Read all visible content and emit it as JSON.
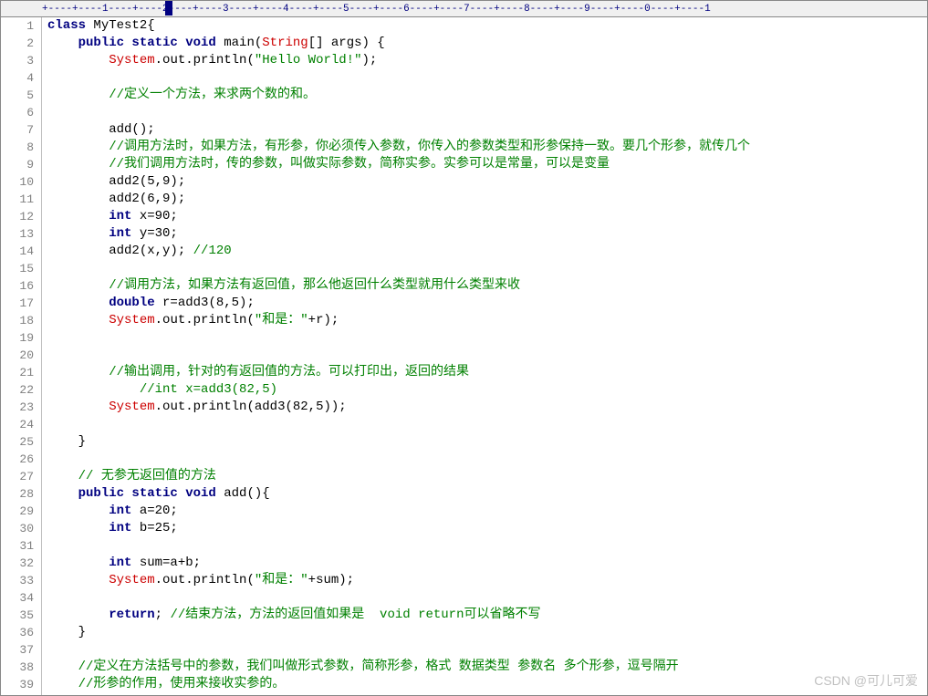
{
  "ruler": "+----+----1----+----2----+----3----+----4----+----5----+----6----+----7----+----8----+----9----+----0----+----1",
  "watermark": "CSDN @可儿可爱",
  "lines": [
    {
      "n": 1,
      "seg": [
        {
          "t": "class ",
          "c": "kw"
        },
        {
          "t": "MyTest2{",
          "c": ""
        }
      ]
    },
    {
      "n": 2,
      "seg": [
        {
          "t": "    ",
          "c": ""
        },
        {
          "t": "public static void ",
          "c": "kw"
        },
        {
          "t": "main(",
          "c": ""
        },
        {
          "t": "String",
          "c": "cls"
        },
        {
          "t": "[] args) {",
          "c": ""
        }
      ]
    },
    {
      "n": 3,
      "seg": [
        {
          "t": "        ",
          "c": ""
        },
        {
          "t": "System",
          "c": "cls"
        },
        {
          "t": ".out.println(",
          "c": ""
        },
        {
          "t": "\"Hello World!\"",
          "c": "str"
        },
        {
          "t": ");",
          "c": ""
        }
      ]
    },
    {
      "n": 4,
      "seg": [
        {
          "t": "",
          "c": ""
        }
      ]
    },
    {
      "n": 5,
      "seg": [
        {
          "t": "        ",
          "c": ""
        },
        {
          "t": "//定义一个方法，来求两个数的和。",
          "c": "cmt"
        }
      ]
    },
    {
      "n": 6,
      "seg": [
        {
          "t": "",
          "c": ""
        }
      ]
    },
    {
      "n": 7,
      "seg": [
        {
          "t": "        add();",
          "c": ""
        }
      ]
    },
    {
      "n": 8,
      "seg": [
        {
          "t": "        ",
          "c": ""
        },
        {
          "t": "//调用方法时，如果方法，有形参，你必须传入参数，你传入的参数类型和形参保持一致。要几个形参，就传几个",
          "c": "cmt"
        }
      ]
    },
    {
      "n": 9,
      "seg": [
        {
          "t": "        ",
          "c": ""
        },
        {
          "t": "//我们调用方法时，传的参数，叫做实际参数，简称实参。实参可以是常量，可以是变量",
          "c": "cmt"
        }
      ]
    },
    {
      "n": 10,
      "seg": [
        {
          "t": "        add2(5,9);",
          "c": ""
        }
      ]
    },
    {
      "n": 11,
      "seg": [
        {
          "t": "        add2(6,9);",
          "c": ""
        }
      ]
    },
    {
      "n": 12,
      "seg": [
        {
          "t": "        ",
          "c": ""
        },
        {
          "t": "int ",
          "c": "kw"
        },
        {
          "t": "x=90;",
          "c": ""
        }
      ]
    },
    {
      "n": 13,
      "seg": [
        {
          "t": "        ",
          "c": ""
        },
        {
          "t": "int ",
          "c": "kw"
        },
        {
          "t": "y=30;",
          "c": ""
        }
      ]
    },
    {
      "n": 14,
      "seg": [
        {
          "t": "        add2(x,y); ",
          "c": ""
        },
        {
          "t": "//120",
          "c": "cmt"
        }
      ]
    },
    {
      "n": 15,
      "seg": [
        {
          "t": "",
          "c": ""
        }
      ]
    },
    {
      "n": 16,
      "seg": [
        {
          "t": "        ",
          "c": ""
        },
        {
          "t": "//调用方法，如果方法有返回值，那么他返回什么类型就用什么类型来收",
          "c": "cmt"
        }
      ]
    },
    {
      "n": 17,
      "seg": [
        {
          "t": "        ",
          "c": ""
        },
        {
          "t": "double ",
          "c": "kw"
        },
        {
          "t": "r=add3(8,5);",
          "c": ""
        }
      ]
    },
    {
      "n": 18,
      "seg": [
        {
          "t": "        ",
          "c": ""
        },
        {
          "t": "System",
          "c": "cls"
        },
        {
          "t": ".out.println(",
          "c": ""
        },
        {
          "t": "\"和是：\"",
          "c": "str"
        },
        {
          "t": "+r);",
          "c": ""
        }
      ]
    },
    {
      "n": 19,
      "seg": [
        {
          "t": "",
          "c": ""
        }
      ]
    },
    {
      "n": 20,
      "seg": [
        {
          "t": "",
          "c": ""
        }
      ]
    },
    {
      "n": 21,
      "seg": [
        {
          "t": "        ",
          "c": ""
        },
        {
          "t": "//输出调用，针对的有返回值的方法。可以打印出，返回的结果",
          "c": "cmt"
        }
      ]
    },
    {
      "n": 22,
      "seg": [
        {
          "t": "            ",
          "c": ""
        },
        {
          "t": "//int x=add3(82,5)",
          "c": "cmt"
        }
      ]
    },
    {
      "n": 23,
      "seg": [
        {
          "t": "        ",
          "c": ""
        },
        {
          "t": "System",
          "c": "cls"
        },
        {
          "t": ".out.println(add3(82,5));",
          "c": ""
        }
      ]
    },
    {
      "n": 24,
      "seg": [
        {
          "t": "",
          "c": ""
        }
      ]
    },
    {
      "n": 25,
      "seg": [
        {
          "t": "    }",
          "c": ""
        }
      ]
    },
    {
      "n": 26,
      "seg": [
        {
          "t": "",
          "c": ""
        }
      ]
    },
    {
      "n": 27,
      "seg": [
        {
          "t": "    ",
          "c": ""
        },
        {
          "t": "// 无参无返回值的方法",
          "c": "cmt"
        }
      ]
    },
    {
      "n": 28,
      "seg": [
        {
          "t": "    ",
          "c": ""
        },
        {
          "t": "public static void ",
          "c": "kw"
        },
        {
          "t": "add(){",
          "c": ""
        }
      ]
    },
    {
      "n": 29,
      "seg": [
        {
          "t": "        ",
          "c": ""
        },
        {
          "t": "int ",
          "c": "kw"
        },
        {
          "t": "a=20;",
          "c": ""
        }
      ]
    },
    {
      "n": 30,
      "seg": [
        {
          "t": "        ",
          "c": ""
        },
        {
          "t": "int ",
          "c": "kw"
        },
        {
          "t": "b=25;",
          "c": ""
        }
      ]
    },
    {
      "n": 31,
      "seg": [
        {
          "t": "",
          "c": ""
        }
      ]
    },
    {
      "n": 32,
      "seg": [
        {
          "t": "        ",
          "c": ""
        },
        {
          "t": "int ",
          "c": "kw"
        },
        {
          "t": "sum=a+b;",
          "c": ""
        }
      ]
    },
    {
      "n": 33,
      "seg": [
        {
          "t": "        ",
          "c": ""
        },
        {
          "t": "System",
          "c": "cls"
        },
        {
          "t": ".out.println(",
          "c": ""
        },
        {
          "t": "\"和是：\"",
          "c": "str"
        },
        {
          "t": "+sum);",
          "c": ""
        }
      ]
    },
    {
      "n": 34,
      "seg": [
        {
          "t": "",
          "c": ""
        }
      ]
    },
    {
      "n": 35,
      "seg": [
        {
          "t": "        ",
          "c": ""
        },
        {
          "t": "return",
          "c": "kw"
        },
        {
          "t": "; ",
          "c": ""
        },
        {
          "t": "//结束方法，方法的返回值如果是  void return可以省略不写",
          "c": "cmt"
        }
      ]
    },
    {
      "n": 36,
      "seg": [
        {
          "t": "    }",
          "c": ""
        }
      ]
    },
    {
      "n": 37,
      "seg": [
        {
          "t": "",
          "c": ""
        }
      ]
    },
    {
      "n": 38,
      "seg": [
        {
          "t": "    ",
          "c": ""
        },
        {
          "t": "//定义在方法括号中的参数，我们叫做形式参数，简称形参，格式 数据类型 参数名 多个形参，逗号隔开",
          "c": "cmt"
        }
      ]
    },
    {
      "n": 39,
      "seg": [
        {
          "t": "    ",
          "c": ""
        },
        {
          "t": "//形参的作用，使用来接收实参的。",
          "c": "cmt"
        }
      ]
    }
  ]
}
